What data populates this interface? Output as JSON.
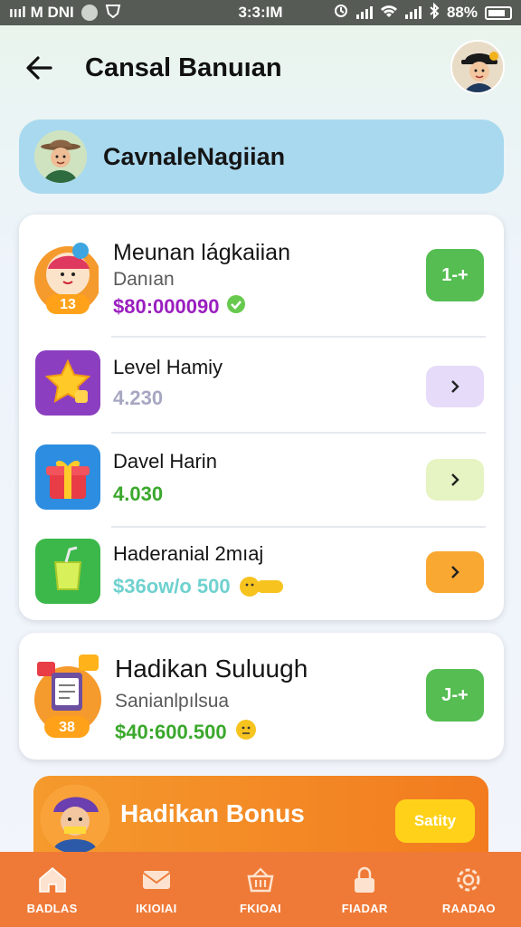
{
  "status_bar": {
    "left_text": "ıııl M DNI",
    "time": "3:3:IM",
    "battery": "88%"
  },
  "header": {
    "title": "Cansal Banuıan"
  },
  "user": {
    "name": "CavnaleNagiian"
  },
  "list": [
    {
      "title": "Meunan lágkaiian",
      "subtitle": "Danıan",
      "badge": "13",
      "value": "$80:000090",
      "value_color": "#9a1fbf",
      "button_label": "1-+",
      "button_color": "#55bd52",
      "icon": "avatar-badge-icon"
    },
    {
      "title": "Level Hamiy",
      "value": "4.230",
      "value_color": "#a7a7c2",
      "button_color": "#e6dbf9",
      "icon": "star-icon"
    },
    {
      "title": "Davel Harin",
      "value": "4.030",
      "value_color": "#3aa82c",
      "button_color": "#e6f3c2",
      "icon": "gift-icon"
    },
    {
      "title": "Haderanial 2mıaj",
      "value": "$36ow/o 500",
      "value_color": "#6fd1cf",
      "button_color": "#f9a832",
      "icon": "juice-box-icon"
    }
  ],
  "reward": {
    "title": "Hadikan  Suluugh",
    "subtitle": "Sanianlpılsua",
    "badge": "38",
    "value": "$40:600.500",
    "value_color": "#3aa82c",
    "button_label": "J-+",
    "button_color": "#55bd52"
  },
  "bonus": {
    "title": "Hadikan Bonus",
    "button_label": "Satity"
  },
  "nav": [
    {
      "label": "BADLAS",
      "icon": "home-icon"
    },
    {
      "label": "IKIOIAI",
      "icon": "mail-icon"
    },
    {
      "label": "FKIOAI",
      "icon": "basket-icon"
    },
    {
      "label": "FIADAR",
      "icon": "lock-icon"
    },
    {
      "label": "RAADAO",
      "icon": "settings-icon"
    }
  ]
}
